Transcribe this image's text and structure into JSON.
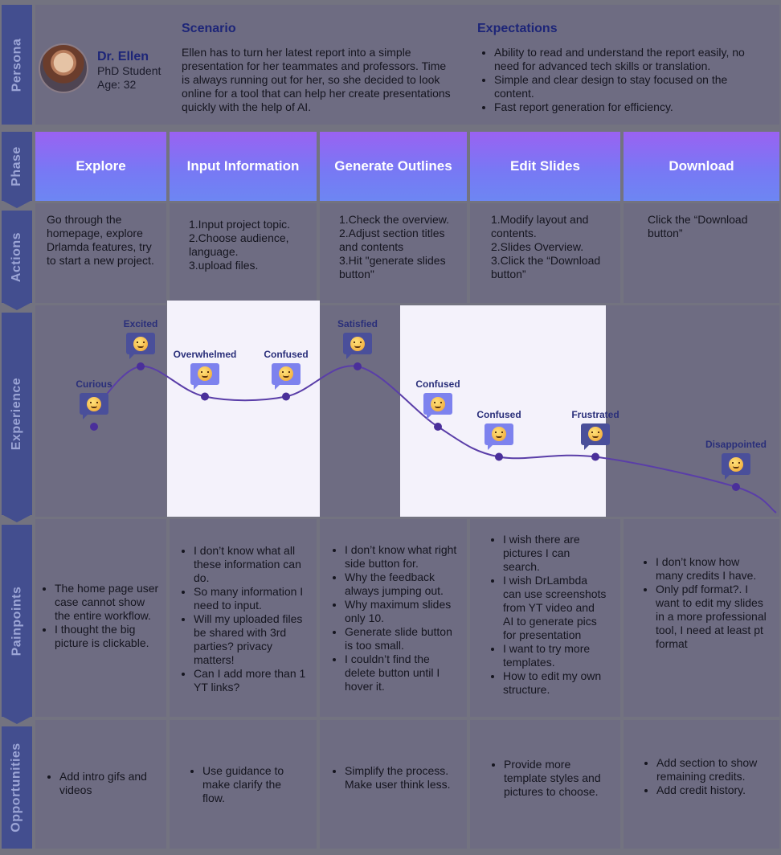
{
  "rows": {
    "persona": "Persona",
    "phase": "Phase",
    "actions": "Actions",
    "experience": "Experience",
    "painpoints": "Painpoints",
    "opportunities": "Opportunities"
  },
  "persona": {
    "name": "Dr. Ellen",
    "role": "PhD Student",
    "age": "Age: 32",
    "scenario_title": "Scenario",
    "scenario_text": "Ellen has to turn her latest report into a simple presentation for her teammates and professors. Time is always running out for her, so she decided to look online for a tool that can help her create presentations quickly with the help of AI.",
    "expectations_title": "Expectations",
    "expectations": [
      "Ability to read and understand the report easily, no need for advanced tech skills or translation.",
      "Simple and clear design to stay focused on the content.",
      "Fast report generation for efficiency."
    ]
  },
  "phases": [
    "Explore",
    "Input Information",
    "Generate Outlines",
    "Edit Slides",
    "Download"
  ],
  "actions": [
    "Go through the homepage, explore Drlamda features, try to start a new project.",
    "1.Input project topic.\n2.Choose audience, language.\n3.upload files.",
    "1.Check the overview.\n2.Adjust section titles and contents\n3.Hit \"generate slides button\"",
    "1.Modify layout and contents.\n2.Slides Overview.\n3.Click the “Download button”",
    "Click the “Download button”"
  ],
  "emotions": [
    {
      "label": "Curious",
      "value": 2
    },
    {
      "label": "Excited",
      "value": 4
    },
    {
      "label": "Overwhelmed",
      "value": 3
    },
    {
      "label": "Confused",
      "value": 3
    },
    {
      "label": "Satisfied",
      "value": 4
    },
    {
      "label": "Confused",
      "value": 2
    },
    {
      "label": "Confused",
      "value": 1
    },
    {
      "label": "Frustrated",
      "value": 1
    },
    {
      "label": "Disappointed",
      "value": 0
    }
  ],
  "painpoints": [
    [
      "The home page user case cannot show the entire workflow.",
      "I thought the big picture is clickable."
    ],
    [
      "I don’t know what all these information can do.",
      "So many information I need to input.",
      "Will my uploaded files be shared with 3rd parties? privacy matters!",
      "Can I add more than 1 YT links?"
    ],
    [
      "I don’t know what right side button for.",
      "Why the feedback always jumping out.",
      "Why maximum slides only 10.",
      "Generate slide button is too small.",
      "I couldn’t find the delete button until I hover it."
    ],
    [
      "I wish there are pictures I can search.",
      "I wish DrLambda can use screenshots from YT video and AI to generate pics for presentation",
      "I want to try more templates.",
      "How to edit my own structure."
    ],
    [
      "I don’t know how many credits I have.",
      "Only pdf format?. I want to edit my slides in a more professional tool, I need at least pt format"
    ]
  ],
  "opportunities": [
    [
      "Add intro gifs and videos"
    ],
    [
      "Use guidance to make clarify the flow."
    ],
    [
      "Simplify the process. Make user think less."
    ],
    [
      "Provide more template styles and pictures to choose."
    ],
    [
      "Add section to show remaining credits.",
      "Add credit history."
    ]
  ],
  "colors": {
    "sidebar": "#434e8f",
    "curve": "#5a3ea8",
    "phase_gradient_top": "#9a62f2",
    "phase_gradient_bottom": "#6d86f3"
  }
}
